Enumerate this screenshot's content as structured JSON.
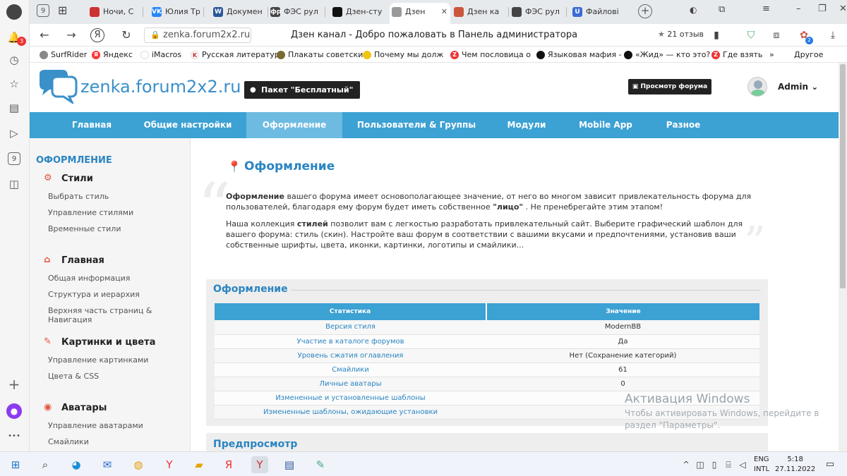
{
  "browser": {
    "sidebar_badge": "3",
    "sidebar_box1": "9",
    "sidebar_box2": "9",
    "sidebar_dots": "•••",
    "tabs": [
      {
        "label": "Ночи, С",
        "fav_color": "#c33"
      },
      {
        "label": "Юлия Тр",
        "fav_color": "#2787f5"
      },
      {
        "label": "Докумен",
        "fav_color": "#2b579a"
      },
      {
        "label": "ФЭС рул",
        "fav_color": "#444"
      },
      {
        "label": "Дзен-сту",
        "fav_color": "#111"
      },
      {
        "label": "Дзен",
        "fav_color": "#999"
      },
      {
        "label": "Дзен ка",
        "fav_color": "#c9563c"
      },
      {
        "label": "ФЭС рул",
        "fav_color": "#444"
      },
      {
        "label": "Файлові",
        "fav_color": "#3b6bd6"
      }
    ],
    "fav_letters": [
      "",
      "VK",
      "W",
      "фр",
      "",
      "",
      "",
      "",
      "U"
    ],
    "url": "zenka.forum2x2.ru",
    "page_title": "Дзен канал - Добро пожаловать в Панель администратора",
    "rating_star": "★",
    "rating_text": "21 отзыв",
    "ext_badge": "2",
    "bookmarks": [
      {
        "label": "SurfRider",
        "color": "#888"
      },
      {
        "label": "Яндекс",
        "color": "#f33"
      },
      {
        "label": "iMacros",
        "color": "#fff"
      },
      {
        "label": "Русская литератур",
        "color": "#fff"
      },
      {
        "label": "Плакаты советски",
        "color": "#7a6a2e"
      },
      {
        "label": "Почему мы долж",
        "color": "#f1c40f"
      },
      {
        "label": "Чем пословица о",
        "color": "#e33"
      },
      {
        "label": "Языковая мафия -",
        "color": "#111"
      },
      {
        "label": "«Жид» — кто это?",
        "color": "#111"
      },
      {
        "label": "Где взять",
        "color": "#e33"
      }
    ],
    "bookmark_letters": [
      "",
      "Я",
      "",
      "K",
      "",
      "",
      "Z",
      "",
      "",
      "Z"
    ],
    "bookmarks_more": "»",
    "bookmarks_other": "Другое"
  },
  "site": {
    "logo_text": "zenka.forum2x2.ru",
    "package_label": "Пакет \"Бесплатный\"",
    "preview_label": "Просмотр форума",
    "admin_label": "Admin",
    "nav": [
      {
        "label": "Главная"
      },
      {
        "label": "Общие настройки"
      },
      {
        "label": "Оформление"
      },
      {
        "label": "Пользователи & Группы"
      },
      {
        "label": "Модули"
      },
      {
        "label": "Mobile App"
      },
      {
        "label": "Разное"
      }
    ],
    "sidebar": {
      "heading": "ОФОРМЛЕНИЕ",
      "groups": [
        {
          "title": "Стили",
          "links": [
            "Выбрать стиль",
            "Управление стилями",
            "Временные стили"
          ]
        },
        {
          "title": "Главная",
          "links": [
            "Общая информация",
            "Структура и иерархия",
            "Верхняя часть страниц & Навигация"
          ]
        },
        {
          "title": "Картинки и цвета",
          "links": [
            "Управление картинками",
            "Цвета & CSS"
          ]
        },
        {
          "title": "Аватары",
          "links": [
            "Управление аватарами",
            "Смайлики"
          ]
        }
      ]
    },
    "content": {
      "title": "Оформление",
      "quote_open": "“",
      "quote_close": "”",
      "p1_bold": "Оформление",
      "p1_text": " вашего форума имеет основополагающее значение, от него во многом зависит привлекательность форума для пользователей, благодаря ему форум будет иметь собственное ",
      "p1_bold2": "\"лицо\"",
      "p1_end": " . Не пренебрегайте этим этапом!",
      "p2_pre": "Наша коллекция ",
      "p2_bold": "стилей",
      "p2_text": " позволит вам с легкостью разработать привлекательный сайт. Выберите графический шаблон для вашего форума: стиль (скин). Настройте ваш форум в соответствии с вашими вкусами и предпочтениями, установив ваши собственные шрифты, цвета, иконки, картинки, логотипы и смайлики...",
      "panel_title": "Оформление",
      "table_head": [
        "Статистика",
        "Значение"
      ],
      "rows": [
        [
          "Версия стиля",
          "ModernBB"
        ],
        [
          "Участие в каталоге форумов",
          "Да"
        ],
        [
          "Уровень сжатия оглавления",
          "Нет (Сохранение категорий)"
        ],
        [
          "Смайлики",
          "61"
        ],
        [
          "Личные аватары",
          "0"
        ],
        [
          "Измененные и установленные шаблоны",
          ""
        ],
        [
          "Измененные шаблоны, ожидающие установки",
          ""
        ]
      ],
      "panel2_title": "Предпросмотр"
    }
  },
  "watermark": {
    "title": "Активация Windows",
    "text": "Чтобы активировать Windows, перейдите в раздел \"Параметры\"."
  },
  "taskbar": {
    "lang": "ENG",
    "lang2": "INTL",
    "time": "5:18",
    "date": "27.11.2022"
  }
}
